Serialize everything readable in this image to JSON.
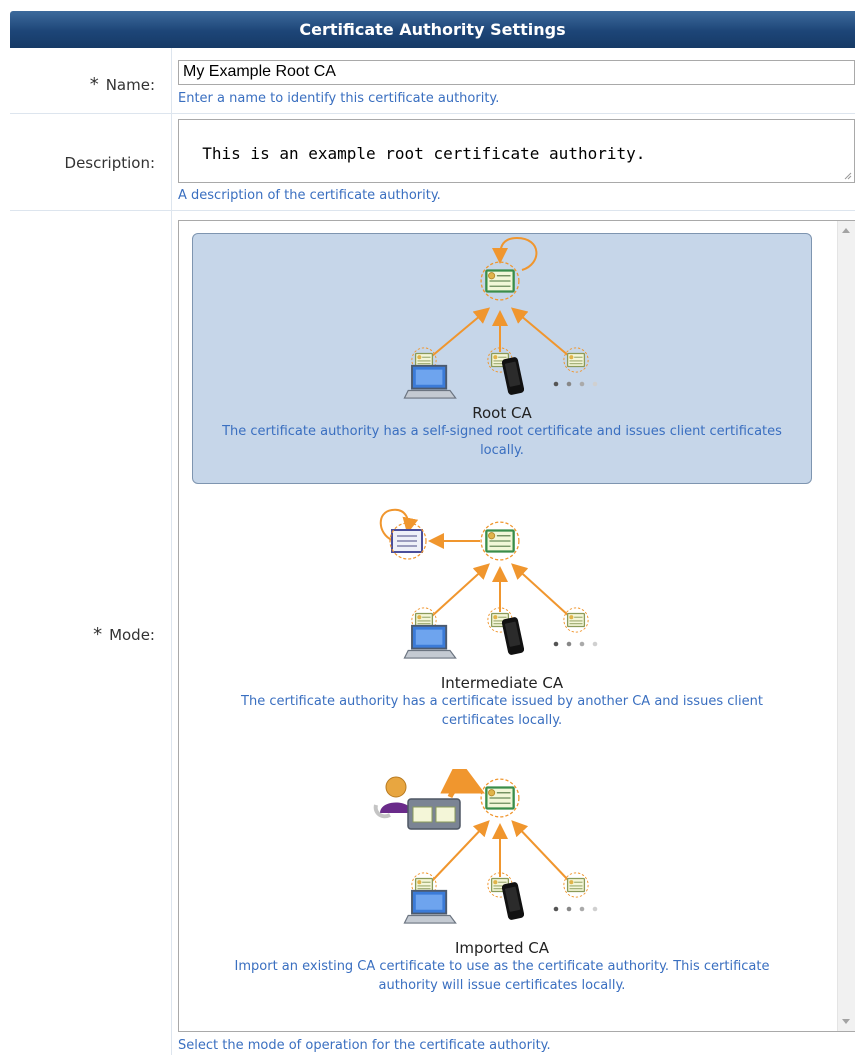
{
  "header": {
    "title": "Certificate Authority Settings"
  },
  "name_field": {
    "label": "Name:",
    "required_mark": "*",
    "value": "My Example Root CA",
    "hint": "Enter a name to identify this certificate authority."
  },
  "description_field": {
    "label": "Description:",
    "value": "This is an example root certificate authority.",
    "hint": "A description of the certificate authority."
  },
  "mode_field": {
    "label": "Mode:",
    "required_mark": "*",
    "hint": "Select the mode of operation for the certificate authority.",
    "selected": "Root CA",
    "options": [
      {
        "title": "Root CA",
        "description": "The certificate authority has a self-signed root certificate and issues client certificates locally."
      },
      {
        "title": "Intermediate CA",
        "description": "The certificate authority has a certificate issued by another CA and issues client certificates locally."
      },
      {
        "title": "Imported CA",
        "description": "Import an existing CA certificate to use as the certificate authority. This certificate authority will issue certificates locally."
      }
    ]
  },
  "colors": {
    "header_bg": "#1d4577",
    "hint_text": "#3a6fc0",
    "selected_bg": "#c6d6e9",
    "arrow": "#f0962e",
    "certificate_green": "#3a8d4a"
  }
}
